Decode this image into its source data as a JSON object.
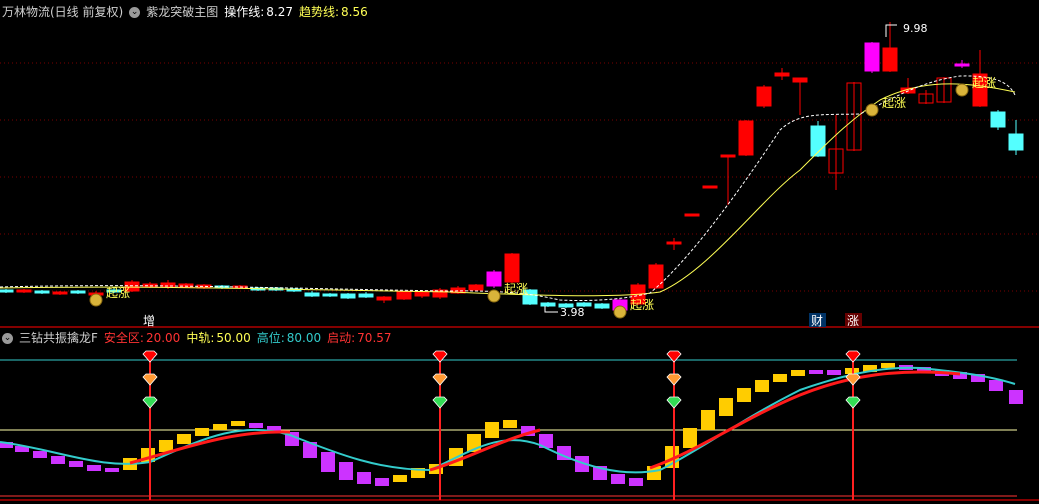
{
  "top_panel": {
    "stock_title": "万林物流(日线 前复权)",
    "indicator_name": "紫龙突破主图",
    "op_line_label": "操作线:",
    "op_line_value": "8.27",
    "trend_line_label": "趋势线:",
    "trend_line_value": "8.56",
    "high_price_label": "9.98",
    "low_price_label": "3.98",
    "signal_text": "起涨",
    "bottom_markers": [
      "增",
      "财",
      "涨"
    ]
  },
  "bottom_panel": {
    "indicator_name": "三钻共振擒龙F",
    "safe_label": "安全区:",
    "safe_value": "20.00",
    "mid_label": "中轨:",
    "mid_value": "50.00",
    "high_label": "高位:",
    "high_value": "80.00",
    "start_label": "启动:",
    "start_value": "70.57"
  },
  "colors": {
    "up": "#ff0000",
    "down": "#54ffff",
    "magenta": "#ff00ff",
    "yellow": "#ffff55",
    "gold": "#ffcc00",
    "orange": "#ff9933",
    "cyan": "#33cccc",
    "purple": "#cc33ff"
  }
}
